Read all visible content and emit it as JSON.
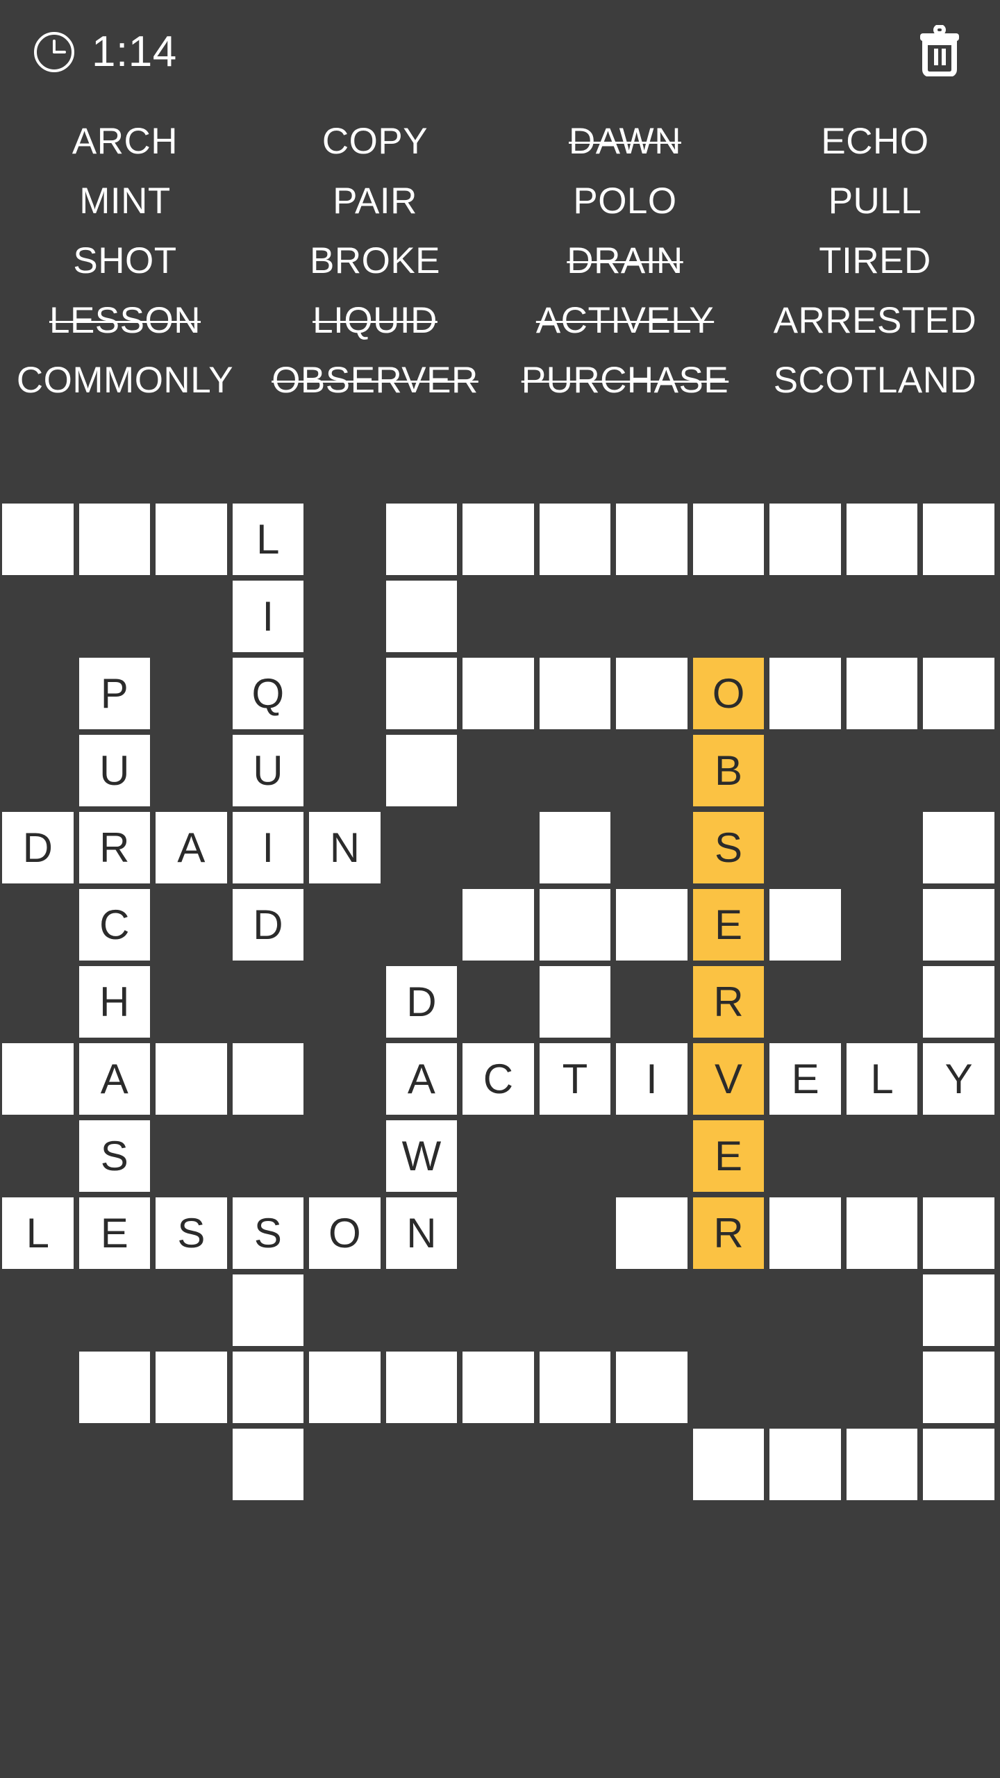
{
  "header": {
    "timer": "1:14",
    "clock_icon": "clock-icon",
    "trash_icon": "trash-icon",
    "trash_label": "Clear"
  },
  "colors": {
    "background": "#3d3d3d",
    "cell": "#ffffff",
    "highlight": "#fbc243",
    "letter": "#2b2b2b",
    "text": "#ffffff"
  },
  "word_list": {
    "rows": [
      [
        {
          "word": "ARCH",
          "found": false
        },
        {
          "word": "COPY",
          "found": false
        },
        {
          "word": "DAWN",
          "found": true
        },
        {
          "word": "ECHO",
          "found": false
        }
      ],
      [
        {
          "word": "MINT",
          "found": false
        },
        {
          "word": "PAIR",
          "found": false
        },
        {
          "word": "POLO",
          "found": false
        },
        {
          "word": "PULL",
          "found": false
        }
      ],
      [
        {
          "word": "SHOT",
          "found": false
        },
        {
          "word": "BROKE",
          "found": false
        },
        {
          "word": "DRAIN",
          "found": true
        },
        {
          "word": "TIRED",
          "found": false
        }
      ],
      [
        {
          "word": "LESSON",
          "found": true
        },
        {
          "word": "LIQUID",
          "found": true
        },
        {
          "word": "ACTIVELY",
          "found": true
        },
        {
          "word": "ARRESTED",
          "found": false
        }
      ],
      [
        {
          "word": "COMMONLY",
          "found": false
        },
        {
          "word": "OBSERVER",
          "found": true
        },
        {
          "word": "PURCHASE",
          "found": true
        },
        {
          "word": "SCOTLAND",
          "found": false
        }
      ]
    ]
  },
  "grid": {
    "columns": 13,
    "rows": 13,
    "cells": [
      [
        {
          "s": "open",
          "l": ""
        },
        {
          "s": "open",
          "l": ""
        },
        {
          "s": "open",
          "l": ""
        },
        {
          "s": "open",
          "l": "L"
        },
        {
          "s": "empty",
          "l": ""
        },
        {
          "s": "open",
          "l": ""
        },
        {
          "s": "open",
          "l": ""
        },
        {
          "s": "open",
          "l": ""
        },
        {
          "s": "open",
          "l": ""
        },
        {
          "s": "open",
          "l": ""
        },
        {
          "s": "open",
          "l": ""
        },
        {
          "s": "open",
          "l": ""
        },
        {
          "s": "open",
          "l": ""
        }
      ],
      [
        {
          "s": "empty",
          "l": ""
        },
        {
          "s": "empty",
          "l": ""
        },
        {
          "s": "empty",
          "l": ""
        },
        {
          "s": "open",
          "l": "I"
        },
        {
          "s": "empty",
          "l": ""
        },
        {
          "s": "open",
          "l": ""
        },
        {
          "s": "empty",
          "l": ""
        },
        {
          "s": "empty",
          "l": ""
        },
        {
          "s": "empty",
          "l": ""
        },
        {
          "s": "empty",
          "l": ""
        },
        {
          "s": "empty",
          "l": ""
        },
        {
          "s": "empty",
          "l": ""
        },
        {
          "s": "empty",
          "l": ""
        }
      ],
      [
        {
          "s": "empty",
          "l": ""
        },
        {
          "s": "open",
          "l": "P"
        },
        {
          "s": "empty",
          "l": ""
        },
        {
          "s": "open",
          "l": "Q"
        },
        {
          "s": "empty",
          "l": ""
        },
        {
          "s": "open",
          "l": ""
        },
        {
          "s": "open",
          "l": ""
        },
        {
          "s": "open",
          "l": ""
        },
        {
          "s": "open",
          "l": ""
        },
        {
          "s": "hl",
          "l": "O"
        },
        {
          "s": "open",
          "l": ""
        },
        {
          "s": "open",
          "l": ""
        },
        {
          "s": "open",
          "l": ""
        }
      ],
      [
        {
          "s": "empty",
          "l": ""
        },
        {
          "s": "open",
          "l": "U"
        },
        {
          "s": "empty",
          "l": ""
        },
        {
          "s": "open",
          "l": "U"
        },
        {
          "s": "empty",
          "l": ""
        },
        {
          "s": "open",
          "l": ""
        },
        {
          "s": "empty",
          "l": ""
        },
        {
          "s": "empty",
          "l": ""
        },
        {
          "s": "empty",
          "l": ""
        },
        {
          "s": "hl",
          "l": "B"
        },
        {
          "s": "empty",
          "l": ""
        },
        {
          "s": "empty",
          "l": ""
        },
        {
          "s": "empty",
          "l": ""
        }
      ],
      [
        {
          "s": "open",
          "l": "D"
        },
        {
          "s": "open",
          "l": "R"
        },
        {
          "s": "open",
          "l": "A"
        },
        {
          "s": "open",
          "l": "I"
        },
        {
          "s": "open",
          "l": "N"
        },
        {
          "s": "empty",
          "l": ""
        },
        {
          "s": "empty",
          "l": ""
        },
        {
          "s": "open",
          "l": ""
        },
        {
          "s": "empty",
          "l": ""
        },
        {
          "s": "hl",
          "l": "S"
        },
        {
          "s": "empty",
          "l": ""
        },
        {
          "s": "empty",
          "l": ""
        },
        {
          "s": "open",
          "l": ""
        }
      ],
      [
        {
          "s": "empty",
          "l": ""
        },
        {
          "s": "open",
          "l": "C"
        },
        {
          "s": "empty",
          "l": ""
        },
        {
          "s": "open",
          "l": "D"
        },
        {
          "s": "empty",
          "l": ""
        },
        {
          "s": "empty",
          "l": ""
        },
        {
          "s": "open",
          "l": ""
        },
        {
          "s": "open",
          "l": ""
        },
        {
          "s": "open",
          "l": ""
        },
        {
          "s": "hl",
          "l": "E"
        },
        {
          "s": "open",
          "l": ""
        },
        {
          "s": "empty",
          "l": ""
        },
        {
          "s": "open",
          "l": ""
        }
      ],
      [
        {
          "s": "empty",
          "l": ""
        },
        {
          "s": "open",
          "l": "H"
        },
        {
          "s": "empty",
          "l": ""
        },
        {
          "s": "empty",
          "l": ""
        },
        {
          "s": "empty",
          "l": ""
        },
        {
          "s": "open",
          "l": "D"
        },
        {
          "s": "empty",
          "l": ""
        },
        {
          "s": "open",
          "l": ""
        },
        {
          "s": "empty",
          "l": ""
        },
        {
          "s": "hl",
          "l": "R"
        },
        {
          "s": "empty",
          "l": ""
        },
        {
          "s": "empty",
          "l": ""
        },
        {
          "s": "open",
          "l": ""
        }
      ],
      [
        {
          "s": "open",
          "l": ""
        },
        {
          "s": "open",
          "l": "A"
        },
        {
          "s": "open",
          "l": ""
        },
        {
          "s": "open",
          "l": ""
        },
        {
          "s": "empty",
          "l": ""
        },
        {
          "s": "open",
          "l": "A"
        },
        {
          "s": "open",
          "l": "C"
        },
        {
          "s": "open",
          "l": "T"
        },
        {
          "s": "open",
          "l": "I"
        },
        {
          "s": "hl",
          "l": "V"
        },
        {
          "s": "open",
          "l": "E"
        },
        {
          "s": "open",
          "l": "L"
        },
        {
          "s": "open",
          "l": "Y"
        }
      ],
      [
        {
          "s": "empty",
          "l": ""
        },
        {
          "s": "open",
          "l": "S"
        },
        {
          "s": "empty",
          "l": ""
        },
        {
          "s": "empty",
          "l": ""
        },
        {
          "s": "empty",
          "l": ""
        },
        {
          "s": "open",
          "l": "W"
        },
        {
          "s": "empty",
          "l": ""
        },
        {
          "s": "empty",
          "l": ""
        },
        {
          "s": "empty",
          "l": ""
        },
        {
          "s": "hl",
          "l": "E"
        },
        {
          "s": "empty",
          "l": ""
        },
        {
          "s": "empty",
          "l": ""
        },
        {
          "s": "empty",
          "l": ""
        }
      ],
      [
        {
          "s": "open",
          "l": "L"
        },
        {
          "s": "open",
          "l": "E"
        },
        {
          "s": "open",
          "l": "S"
        },
        {
          "s": "open",
          "l": "S"
        },
        {
          "s": "open",
          "l": "O"
        },
        {
          "s": "open",
          "l": "N"
        },
        {
          "s": "empty",
          "l": ""
        },
        {
          "s": "empty",
          "l": ""
        },
        {
          "s": "open",
          "l": ""
        },
        {
          "s": "hl",
          "l": "R"
        },
        {
          "s": "open",
          "l": ""
        },
        {
          "s": "open",
          "l": ""
        },
        {
          "s": "open",
          "l": ""
        }
      ],
      [
        {
          "s": "empty",
          "l": ""
        },
        {
          "s": "empty",
          "l": ""
        },
        {
          "s": "empty",
          "l": ""
        },
        {
          "s": "open",
          "l": ""
        },
        {
          "s": "empty",
          "l": ""
        },
        {
          "s": "empty",
          "l": ""
        },
        {
          "s": "empty",
          "l": ""
        },
        {
          "s": "empty",
          "l": ""
        },
        {
          "s": "empty",
          "l": ""
        },
        {
          "s": "empty",
          "l": ""
        },
        {
          "s": "empty",
          "l": ""
        },
        {
          "s": "empty",
          "l": ""
        },
        {
          "s": "open",
          "l": ""
        }
      ],
      [
        {
          "s": "empty",
          "l": ""
        },
        {
          "s": "open",
          "l": ""
        },
        {
          "s": "open",
          "l": ""
        },
        {
          "s": "open",
          "l": ""
        },
        {
          "s": "open",
          "l": ""
        },
        {
          "s": "open",
          "l": ""
        },
        {
          "s": "open",
          "l": ""
        },
        {
          "s": "open",
          "l": ""
        },
        {
          "s": "open",
          "l": ""
        },
        {
          "s": "empty",
          "l": ""
        },
        {
          "s": "empty",
          "l": ""
        },
        {
          "s": "empty",
          "l": ""
        },
        {
          "s": "open",
          "l": ""
        }
      ],
      [
        {
          "s": "empty",
          "l": ""
        },
        {
          "s": "empty",
          "l": ""
        },
        {
          "s": "empty",
          "l": ""
        },
        {
          "s": "open",
          "l": ""
        },
        {
          "s": "empty",
          "l": ""
        },
        {
          "s": "empty",
          "l": ""
        },
        {
          "s": "empty",
          "l": ""
        },
        {
          "s": "empty",
          "l": ""
        },
        {
          "s": "empty",
          "l": ""
        },
        {
          "s": "open",
          "l": ""
        },
        {
          "s": "open",
          "l": ""
        },
        {
          "s": "open",
          "l": ""
        },
        {
          "s": "open",
          "l": ""
        }
      ]
    ]
  }
}
